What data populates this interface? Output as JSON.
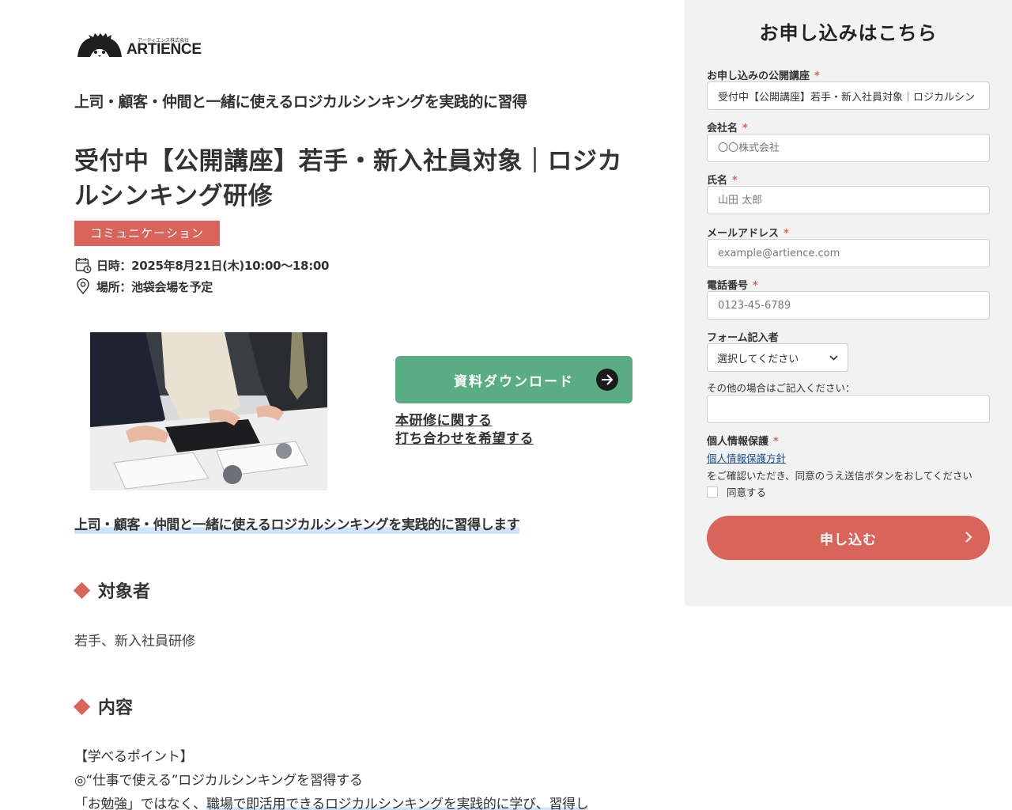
{
  "logo": {
    "company_kana": "アーティエンス株式会社",
    "wordmark": "ARTIENCE"
  },
  "course": {
    "subtitle": "上司・顧客・仲間と一緒に使えるロジカルシンキングを実践的に習得",
    "title": "受付中【公開講座】若手・新入社員対象｜ロジカルシンキング研修",
    "category_badge": "コミュニケーション",
    "date": "日時：2025年8月21日(木)10:00〜18:00",
    "place": "場所：池袋会場を予定",
    "download_label": "資料ダウンロード",
    "inquiry_line1": "本研修に関する",
    "inquiry_line2": "打ち合わせを希望する",
    "lead": "上司・顧客・仲間と一緒に使えるロジカルシンキングを実践的に習得します"
  },
  "sections": {
    "target_heading": "対象者",
    "target_body": "若手、新入社員研修",
    "content_heading": "内容",
    "content_line1": "【学べるポイント】",
    "content_line2": "◎“仕事で使える”ロジカルシンキングを習得する",
    "content_line3_a": "「お勉強」ではなく、",
    "content_line3_b": "職場で即活用できるロジカルシンキングを実践的に学び、習得し"
  },
  "form": {
    "title": "お申し込みはこちら",
    "required_mark": "*",
    "course_label": "お申し込みの公開講座",
    "course_value": "受付中【公開講座】若手・新入社員対象｜ロジカルシン",
    "company_label": "会社名",
    "company_placeholder": "〇〇株式会社",
    "name_label": "氏名",
    "name_placeholder": "山田 太郎",
    "email_label": "メールアドレス",
    "email_placeholder": "example@artience.com",
    "phone_label": "電話番号",
    "phone_placeholder": "0123-45-6789",
    "filler_label": "フォーム記入者",
    "filler_selected": "選択してください",
    "other_label": "その他の場合はご記入ください：",
    "privacy_label": "個人情報保護",
    "privacy_link": "個人情報保護方針",
    "privacy_note": "をご確認いただき、同意のうえ送信ボタンをおしてください",
    "agree_label": "同意する",
    "submit_label": "申し込む"
  },
  "colors": {
    "accent": "#d9655a",
    "download_green": "#5aac83",
    "form_bg": "#f2f2f2",
    "link_blue": "#1d4f86",
    "highlight": "#cfe4f8"
  }
}
